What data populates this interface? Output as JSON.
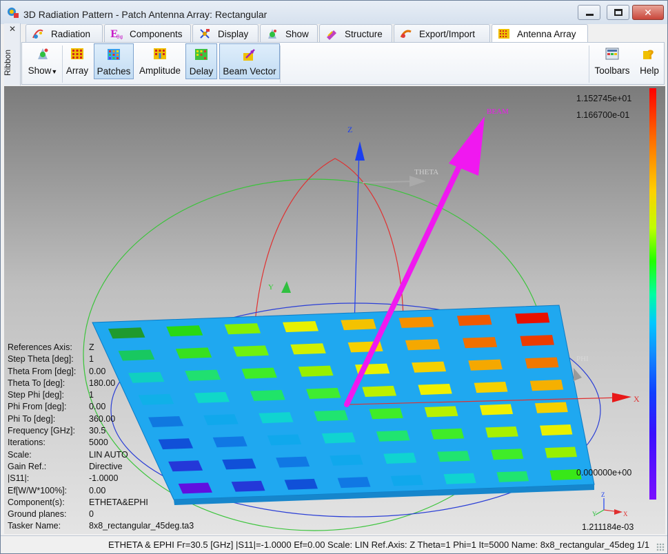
{
  "window": {
    "title": "3D Radiation Pattern - Patch Antenna Array: Rectangular",
    "controls": {
      "minimize": "minimize",
      "maximize": "maximize",
      "close": "✕"
    }
  },
  "ribbon_side": {
    "close": "✕",
    "label": "Ribbon"
  },
  "tabs": [
    {
      "label": "Radiation",
      "icon": "radiation-icon"
    },
    {
      "label": "Components",
      "icon": "components-icon"
    },
    {
      "label": "Display",
      "icon": "display-icon"
    },
    {
      "label": "Show",
      "icon": "show-icon"
    },
    {
      "label": "Structure",
      "icon": "structure-icon"
    },
    {
      "label": "Export/Import",
      "icon": "export-import-icon"
    },
    {
      "label": "Antenna Array",
      "icon": "antenna-array-icon",
      "active": true
    }
  ],
  "ribbon": {
    "buttons": [
      {
        "label": "Show",
        "icon": "show-icon",
        "dropdown": true
      },
      {
        "label": "Array",
        "icon": "array-icon"
      },
      {
        "label": "Patches",
        "icon": "patches-icon",
        "active": true
      },
      {
        "label": "Amplitude",
        "icon": "amplitude-icon"
      },
      {
        "label": "Delay",
        "icon": "delay-icon",
        "active": true
      },
      {
        "label": "Beam Vector",
        "icon": "beam-vector-icon",
        "active": true
      },
      {
        "label": "Toolbars",
        "icon": "toolbars-icon"
      },
      {
        "label": "Help",
        "icon": "help-icon"
      }
    ]
  },
  "viewport": {
    "axes": {
      "z": "Z",
      "y": "Y",
      "x": "X",
      "theta": "THETA",
      "phi": "PHI",
      "beam": "BEAM"
    },
    "legend": {
      "max_top": "1.152745e+01",
      "max_second": "1.166700e-01",
      "min": "0.000000e+00",
      "bottom": "1.211184e-03"
    },
    "info": [
      {
        "key": "References Axis:",
        "value": "Z"
      },
      {
        "key": "Step Theta [deg]:",
        "value": "1"
      },
      {
        "key": "Theta From [deg]:",
        "value": "0.00"
      },
      {
        "key": "Theta To [deg]:",
        "value": "180.00"
      },
      {
        "key": "Step Phi [deg]:",
        "value": "1"
      },
      {
        "key": "Phi From [deg]:",
        "value": "0.00"
      },
      {
        "key": "Phi To [deg]:",
        "value": "360.00"
      },
      {
        "key": "Frequency [GHz]:",
        "value": "30.5"
      },
      {
        "key": "Iterations:",
        "value": "5000"
      },
      {
        "key": "Scale:",
        "value": "LIN AUTO"
      },
      {
        "key": "Gain Ref.:",
        "value": "Directive"
      },
      {
        "key": "|S11|:",
        "value": "-1.0000"
      },
      {
        "key": "Ef[W/W*100%]:",
        "value": "0.00"
      },
      {
        "key": "Component(s):",
        "value": "ETHETA&EPHI"
      },
      {
        "key": "Ground planes:",
        "value": "0"
      },
      {
        "key": "Tasker Name:",
        "value": "8x8_rectangular_45deg.ta3"
      }
    ],
    "patch_colors": [
      [
        "#1f9a2e",
        "#29d814",
        "#86f004",
        "#e8f000",
        "#f4c200",
        "#f59000",
        "#f05a00",
        "#e81000"
      ],
      [
        "#18c860",
        "#38e020",
        "#70f010",
        "#d0f000",
        "#f5d000",
        "#f5a800",
        "#f07000",
        "#ec3c00"
      ],
      [
        "#10d0c0",
        "#20e070",
        "#40ec28",
        "#98f000",
        "#e8f000",
        "#f5d000",
        "#f5a800",
        "#f07800"
      ],
      [
        "#10b0e8",
        "#10d8c8",
        "#20e468",
        "#40ec30",
        "#bcf000",
        "#f0f000",
        "#f5d000",
        "#f5b000"
      ],
      [
        "#1078e0",
        "#10a8ec",
        "#10d4d0",
        "#20e470",
        "#40ec28",
        "#b8f000",
        "#f0f000",
        "#f5d000"
      ],
      [
        "#1050d8",
        "#1078e4",
        "#10a8ec",
        "#10d4d0",
        "#20e470",
        "#40ec28",
        "#a8f000",
        "#e8f000"
      ],
      [
        "#2438d8",
        "#1050d8",
        "#1078e4",
        "#10a8ec",
        "#10d4d0",
        "#20e470",
        "#40ec28",
        "#98f000"
      ],
      [
        "#6010e0",
        "#2438d8",
        "#1050d8",
        "#1078e4",
        "#10a8ec",
        "#10d4d0",
        "#20e470",
        "#38e818"
      ]
    ]
  },
  "status": {
    "text": "ETHETA & EPHI  Fr=30.5 [GHz]  |S11|=-1.0000  Ef=0.00  Scale: LIN  Ref.Axis: Z  Theta=1  Phi=1  It=5000  Name: 8x8_rectangular_45deg 1/1"
  }
}
